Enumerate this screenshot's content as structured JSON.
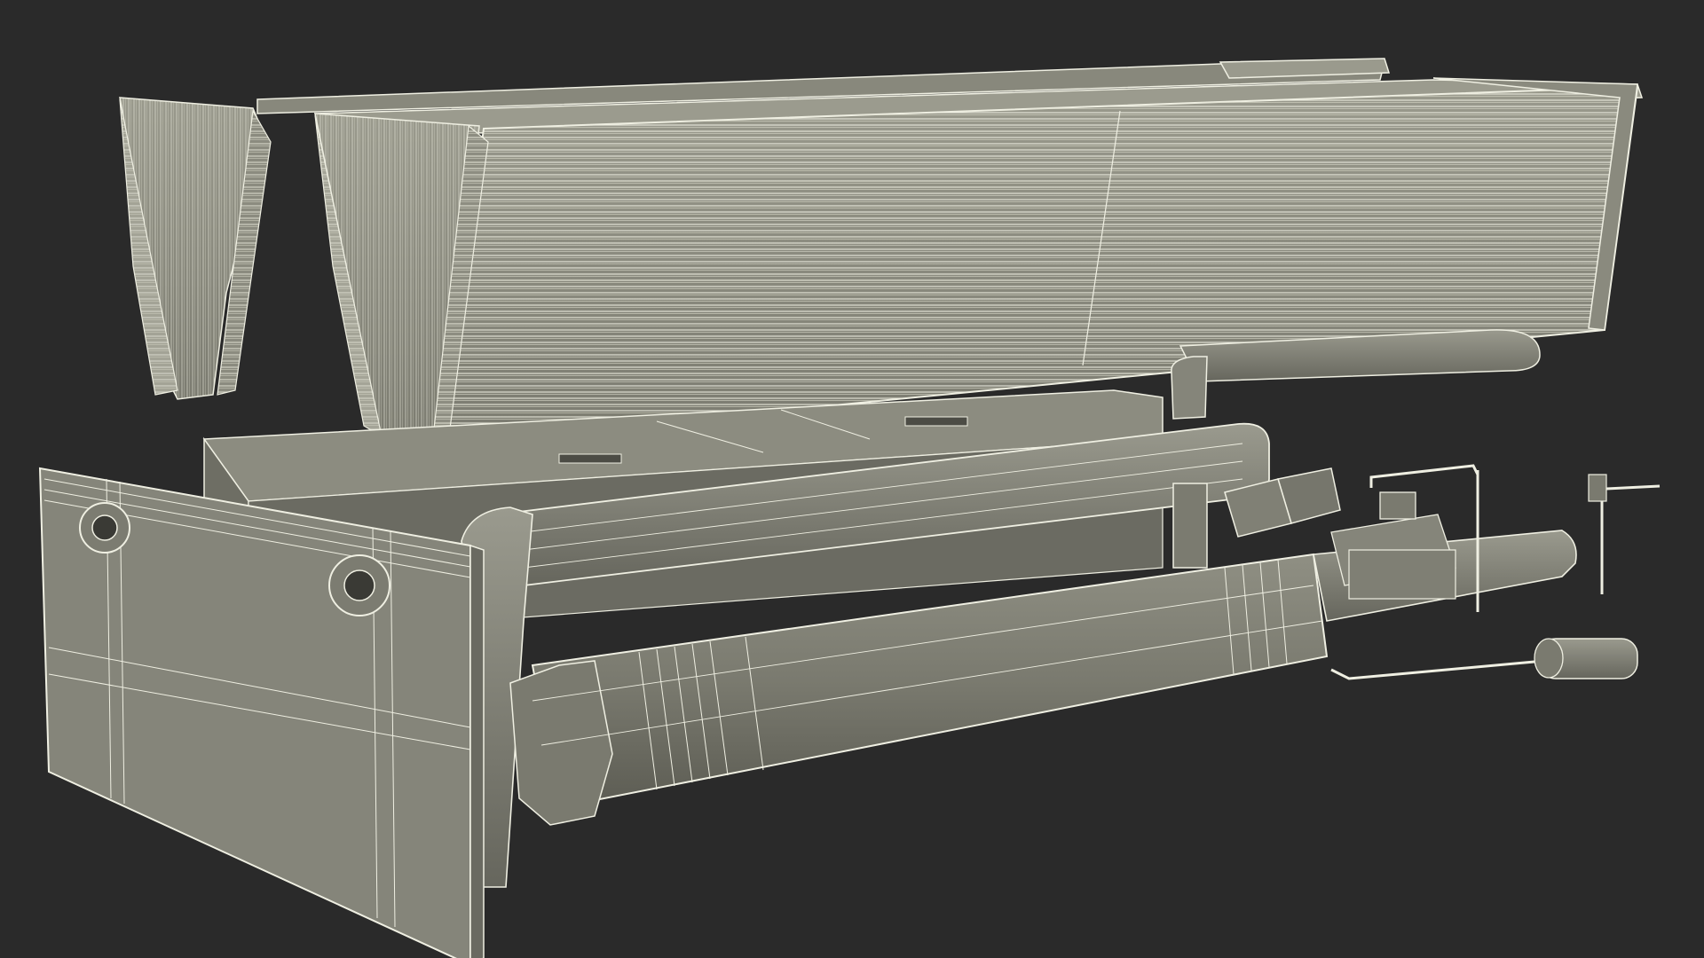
{
  "scene": {
    "subject": "wireframe-3d-render",
    "colors": {
      "background": "#2a2a2a",
      "surface_light": "#8a8a7e",
      "surface_mid": "#77776c",
      "surface_dark": "#5f5f56",
      "wire": "#efefe2",
      "wire_dense": "#d8d8c9"
    }
  }
}
